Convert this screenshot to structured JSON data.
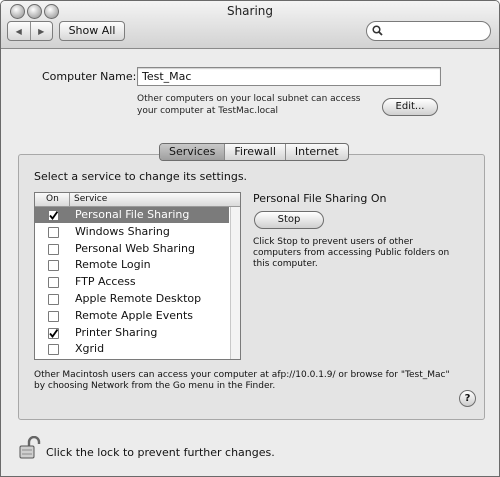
{
  "window": {
    "title": "Sharing"
  },
  "toolbar": {
    "back_label": "◀",
    "forward_label": "▶",
    "show_all_label": "Show All",
    "search_placeholder": ""
  },
  "computer_name": {
    "label": "Computer Name:",
    "value": "Test_Mac",
    "info": "Other computers on your local subnet can access your computer at TestMac.local",
    "edit_label": "Edit..."
  },
  "tabs": [
    {
      "label": "Services",
      "active": true
    },
    {
      "label": "Firewall",
      "active": false
    },
    {
      "label": "Internet",
      "active": false
    }
  ],
  "services": {
    "prompt": "Select a service to change its settings.",
    "col_on": "On",
    "col_service": "Service",
    "items": [
      {
        "label": "Personal File Sharing",
        "checked": true,
        "selected": true
      },
      {
        "label": "Windows Sharing",
        "checked": false,
        "selected": false
      },
      {
        "label": "Personal Web Sharing",
        "checked": false,
        "selected": false
      },
      {
        "label": "Remote Login",
        "checked": false,
        "selected": false
      },
      {
        "label": "FTP Access",
        "checked": false,
        "selected": false
      },
      {
        "label": "Apple Remote Desktop",
        "checked": false,
        "selected": false
      },
      {
        "label": "Remote Apple Events",
        "checked": false,
        "selected": false
      },
      {
        "label": "Printer Sharing",
        "checked": true,
        "selected": false
      },
      {
        "label": "Xgrid",
        "checked": false,
        "selected": false
      }
    ]
  },
  "detail": {
    "status": "Personal File Sharing On",
    "stop_label": "Stop",
    "help_text": "Click Stop to prevent users of other computers from accessing Public folders on this computer."
  },
  "footer": {
    "afp_text": "Other Macintosh users can access your computer at afp://10.0.1.9/ or browse for \"Test_Mac\" by choosing Network from the Go menu in the Finder.",
    "help_label": "?",
    "lock_text": "Click the lock to prevent further changes."
  }
}
